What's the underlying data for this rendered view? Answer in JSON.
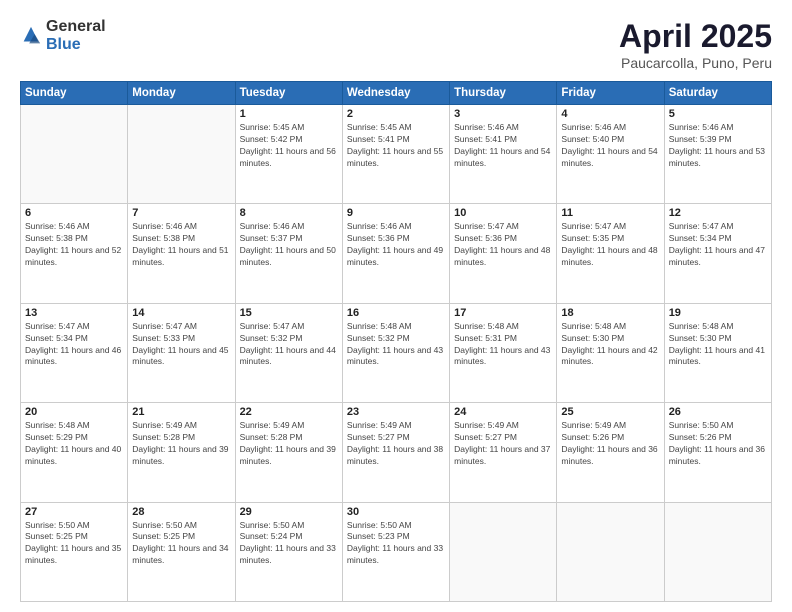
{
  "logo": {
    "general": "General",
    "blue": "Blue"
  },
  "title": {
    "month": "April 2025",
    "location": "Paucarcolla, Puno, Peru"
  },
  "weekdays": [
    "Sunday",
    "Monday",
    "Tuesday",
    "Wednesday",
    "Thursday",
    "Friday",
    "Saturday"
  ],
  "weeks": [
    [
      {
        "day": "",
        "sunrise": "",
        "sunset": "",
        "daylight": ""
      },
      {
        "day": "",
        "sunrise": "",
        "sunset": "",
        "daylight": ""
      },
      {
        "day": "1",
        "sunrise": "Sunrise: 5:45 AM",
        "sunset": "Sunset: 5:42 PM",
        "daylight": "Daylight: 11 hours and 56 minutes."
      },
      {
        "day": "2",
        "sunrise": "Sunrise: 5:45 AM",
        "sunset": "Sunset: 5:41 PM",
        "daylight": "Daylight: 11 hours and 55 minutes."
      },
      {
        "day": "3",
        "sunrise": "Sunrise: 5:46 AM",
        "sunset": "Sunset: 5:41 PM",
        "daylight": "Daylight: 11 hours and 54 minutes."
      },
      {
        "day": "4",
        "sunrise": "Sunrise: 5:46 AM",
        "sunset": "Sunset: 5:40 PM",
        "daylight": "Daylight: 11 hours and 54 minutes."
      },
      {
        "day": "5",
        "sunrise": "Sunrise: 5:46 AM",
        "sunset": "Sunset: 5:39 PM",
        "daylight": "Daylight: 11 hours and 53 minutes."
      }
    ],
    [
      {
        "day": "6",
        "sunrise": "Sunrise: 5:46 AM",
        "sunset": "Sunset: 5:38 PM",
        "daylight": "Daylight: 11 hours and 52 minutes."
      },
      {
        "day": "7",
        "sunrise": "Sunrise: 5:46 AM",
        "sunset": "Sunset: 5:38 PM",
        "daylight": "Daylight: 11 hours and 51 minutes."
      },
      {
        "day": "8",
        "sunrise": "Sunrise: 5:46 AM",
        "sunset": "Sunset: 5:37 PM",
        "daylight": "Daylight: 11 hours and 50 minutes."
      },
      {
        "day": "9",
        "sunrise": "Sunrise: 5:46 AM",
        "sunset": "Sunset: 5:36 PM",
        "daylight": "Daylight: 11 hours and 49 minutes."
      },
      {
        "day": "10",
        "sunrise": "Sunrise: 5:47 AM",
        "sunset": "Sunset: 5:36 PM",
        "daylight": "Daylight: 11 hours and 48 minutes."
      },
      {
        "day": "11",
        "sunrise": "Sunrise: 5:47 AM",
        "sunset": "Sunset: 5:35 PM",
        "daylight": "Daylight: 11 hours and 48 minutes."
      },
      {
        "day": "12",
        "sunrise": "Sunrise: 5:47 AM",
        "sunset": "Sunset: 5:34 PM",
        "daylight": "Daylight: 11 hours and 47 minutes."
      }
    ],
    [
      {
        "day": "13",
        "sunrise": "Sunrise: 5:47 AM",
        "sunset": "Sunset: 5:34 PM",
        "daylight": "Daylight: 11 hours and 46 minutes."
      },
      {
        "day": "14",
        "sunrise": "Sunrise: 5:47 AM",
        "sunset": "Sunset: 5:33 PM",
        "daylight": "Daylight: 11 hours and 45 minutes."
      },
      {
        "day": "15",
        "sunrise": "Sunrise: 5:47 AM",
        "sunset": "Sunset: 5:32 PM",
        "daylight": "Daylight: 11 hours and 44 minutes."
      },
      {
        "day": "16",
        "sunrise": "Sunrise: 5:48 AM",
        "sunset": "Sunset: 5:32 PM",
        "daylight": "Daylight: 11 hours and 43 minutes."
      },
      {
        "day": "17",
        "sunrise": "Sunrise: 5:48 AM",
        "sunset": "Sunset: 5:31 PM",
        "daylight": "Daylight: 11 hours and 43 minutes."
      },
      {
        "day": "18",
        "sunrise": "Sunrise: 5:48 AM",
        "sunset": "Sunset: 5:30 PM",
        "daylight": "Daylight: 11 hours and 42 minutes."
      },
      {
        "day": "19",
        "sunrise": "Sunrise: 5:48 AM",
        "sunset": "Sunset: 5:30 PM",
        "daylight": "Daylight: 11 hours and 41 minutes."
      }
    ],
    [
      {
        "day": "20",
        "sunrise": "Sunrise: 5:48 AM",
        "sunset": "Sunset: 5:29 PM",
        "daylight": "Daylight: 11 hours and 40 minutes."
      },
      {
        "day": "21",
        "sunrise": "Sunrise: 5:49 AM",
        "sunset": "Sunset: 5:28 PM",
        "daylight": "Daylight: 11 hours and 39 minutes."
      },
      {
        "day": "22",
        "sunrise": "Sunrise: 5:49 AM",
        "sunset": "Sunset: 5:28 PM",
        "daylight": "Daylight: 11 hours and 39 minutes."
      },
      {
        "day": "23",
        "sunrise": "Sunrise: 5:49 AM",
        "sunset": "Sunset: 5:27 PM",
        "daylight": "Daylight: 11 hours and 38 minutes."
      },
      {
        "day": "24",
        "sunrise": "Sunrise: 5:49 AM",
        "sunset": "Sunset: 5:27 PM",
        "daylight": "Daylight: 11 hours and 37 minutes."
      },
      {
        "day": "25",
        "sunrise": "Sunrise: 5:49 AM",
        "sunset": "Sunset: 5:26 PM",
        "daylight": "Daylight: 11 hours and 36 minutes."
      },
      {
        "day": "26",
        "sunrise": "Sunrise: 5:50 AM",
        "sunset": "Sunset: 5:26 PM",
        "daylight": "Daylight: 11 hours and 36 minutes."
      }
    ],
    [
      {
        "day": "27",
        "sunrise": "Sunrise: 5:50 AM",
        "sunset": "Sunset: 5:25 PM",
        "daylight": "Daylight: 11 hours and 35 minutes."
      },
      {
        "day": "28",
        "sunrise": "Sunrise: 5:50 AM",
        "sunset": "Sunset: 5:25 PM",
        "daylight": "Daylight: 11 hours and 34 minutes."
      },
      {
        "day": "29",
        "sunrise": "Sunrise: 5:50 AM",
        "sunset": "Sunset: 5:24 PM",
        "daylight": "Daylight: 11 hours and 33 minutes."
      },
      {
        "day": "30",
        "sunrise": "Sunrise: 5:50 AM",
        "sunset": "Sunset: 5:23 PM",
        "daylight": "Daylight: 11 hours and 33 minutes."
      },
      {
        "day": "",
        "sunrise": "",
        "sunset": "",
        "daylight": ""
      },
      {
        "day": "",
        "sunrise": "",
        "sunset": "",
        "daylight": ""
      },
      {
        "day": "",
        "sunrise": "",
        "sunset": "",
        "daylight": ""
      }
    ]
  ]
}
